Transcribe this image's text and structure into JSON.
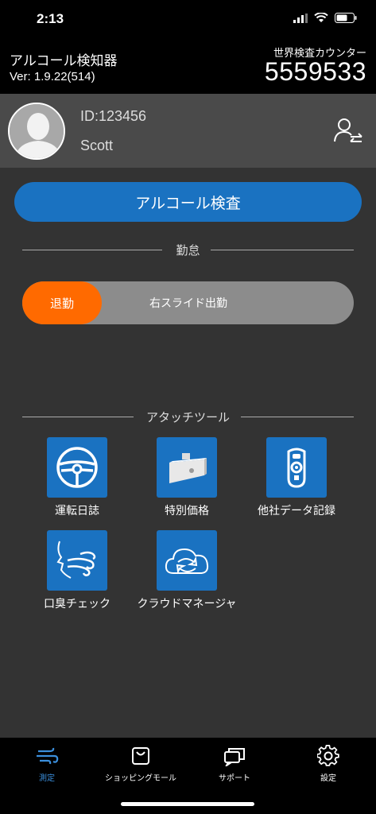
{
  "status_bar": {
    "time": "2:13"
  },
  "header": {
    "app_title": "アルコール検知器",
    "version": "Ver: 1.9.22(514)",
    "counter_label": "世界検査カウンター",
    "counter_value": "5559533"
  },
  "user": {
    "id_text": "ID:123456",
    "name": "Scott"
  },
  "main": {
    "primary_button": "アルコール検査",
    "attendance": {
      "section_title": "勤怠",
      "knob_label": "退勤",
      "slide_hint": "右スライド出勤"
    },
    "tools_section_title": "アタッチツール",
    "tools": [
      {
        "label": "運転日誌",
        "icon": "steering-wheel-icon"
      },
      {
        "label": "特別価格",
        "icon": "device-icon"
      },
      {
        "label": "他社データ記録",
        "icon": "breathalyzer-icon"
      },
      {
        "label": "口臭チェック",
        "icon": "breath-icon"
      },
      {
        "label": "クラウドマネージャ",
        "icon": "cloud-sync-icon"
      }
    ]
  },
  "tab_bar": {
    "tabs": [
      {
        "label": "測定",
        "icon": "wind-icon",
        "active": true
      },
      {
        "label": "ショッピングモール",
        "icon": "shopping-bag-icon",
        "active": false
      },
      {
        "label": "サポート",
        "icon": "chat-icon",
        "active": false
      },
      {
        "label": "設定",
        "icon": "gear-icon",
        "active": false
      }
    ]
  },
  "colors": {
    "accent_blue": "#1a72c1",
    "accent_orange": "#ff6a00",
    "active_tab": "#3b8fdc",
    "background": "#333333"
  }
}
